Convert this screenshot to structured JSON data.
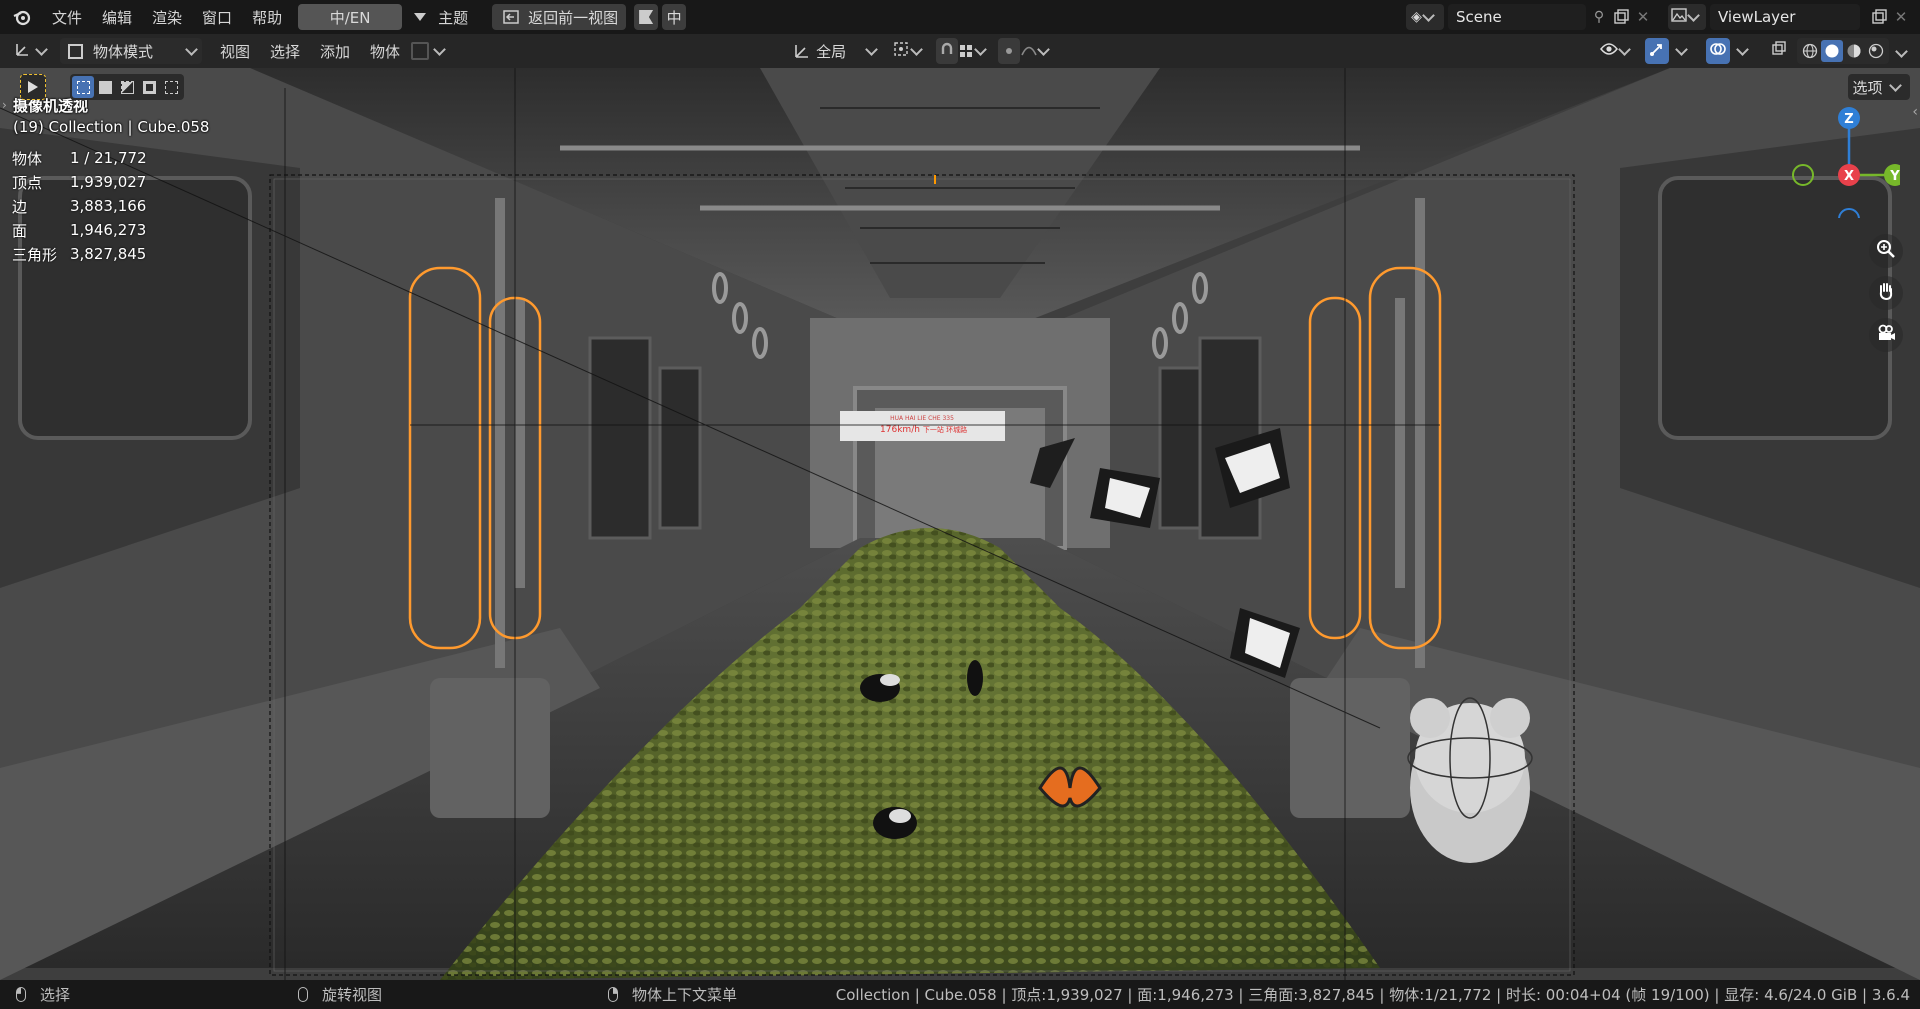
{
  "topmenu": {
    "items": [
      "文件",
      "编辑",
      "渲染",
      "窗口",
      "帮助"
    ],
    "lang_toggle": "中/EN",
    "theme_label": "主题",
    "back_button": "返回前一视图",
    "zh_button": "中"
  },
  "scene": {
    "name": "Scene"
  },
  "viewlayer": {
    "name": "ViewLayer"
  },
  "header": {
    "mode": "物体模式",
    "menus": [
      "视图",
      "选择",
      "添加",
      "物体"
    ],
    "transform_orientation": "全局",
    "options_label": "选项"
  },
  "overlay": {
    "view_name": "摄像机透视",
    "collection_line": "(19) Collection | Cube.058",
    "stats": [
      {
        "label": "物体",
        "value": "1 / 21,772"
      },
      {
        "label": "顶点",
        "value": "1,939,027"
      },
      {
        "label": "边",
        "value": "3,883,166"
      },
      {
        "label": "面",
        "value": "1,946,273"
      },
      {
        "label": "三角形",
        "value": "3,827,845"
      }
    ]
  },
  "gizmo": {
    "z": "Z",
    "x": "X",
    "y": "Y"
  },
  "scene_sign": {
    "line1": "HUA HAI LIE CHE 335",
    "line2": "176km/h",
    "line3": "下一站 环城路"
  },
  "colors": {
    "accent": "#4772b3",
    "x_axis": "#e8414b",
    "y_axis": "#77b82a",
    "z_axis": "#2f7fd6",
    "selection": "#ff9a2e"
  },
  "statusbar": {
    "select": "选择",
    "rotate": "旋转视图",
    "context": "物体上下文菜单",
    "info": "Collection | Cube.058 | 顶点:1,939,027 | 面:1,946,273 | 三角面:3,827,845 | 物体:1/21,772 | 时长: 00:04+04 (帧 19/100) | 显存: 4.6/24.0 GiB | 3.6.4"
  }
}
